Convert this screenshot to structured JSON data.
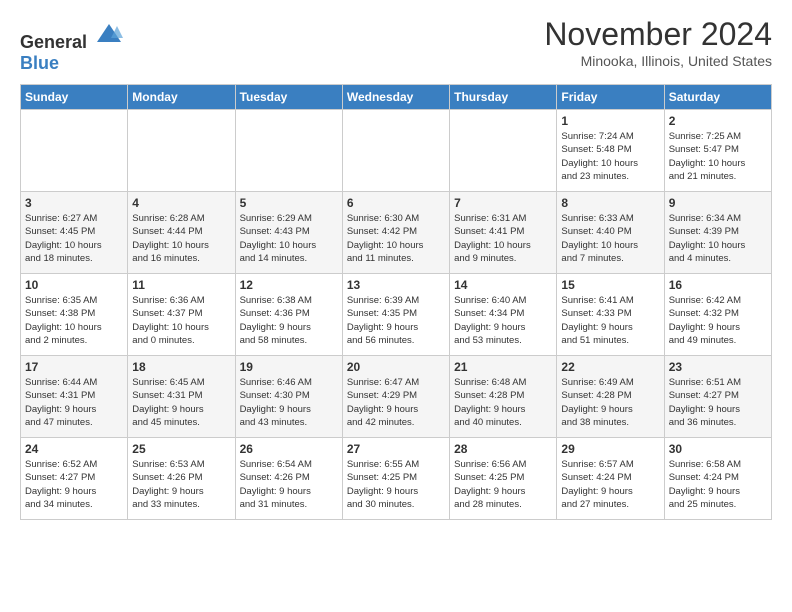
{
  "logo": {
    "text_general": "General",
    "text_blue": "Blue"
  },
  "title": "November 2024",
  "location": "Minooka, Illinois, United States",
  "headers": [
    "Sunday",
    "Monday",
    "Tuesday",
    "Wednesday",
    "Thursday",
    "Friday",
    "Saturday"
  ],
  "rows": [
    [
      {
        "day": "",
        "info": ""
      },
      {
        "day": "",
        "info": ""
      },
      {
        "day": "",
        "info": ""
      },
      {
        "day": "",
        "info": ""
      },
      {
        "day": "",
        "info": ""
      },
      {
        "day": "1",
        "info": "Sunrise: 7:24 AM\nSunset: 5:48 PM\nDaylight: 10 hours\nand 23 minutes."
      },
      {
        "day": "2",
        "info": "Sunrise: 7:25 AM\nSunset: 5:47 PM\nDaylight: 10 hours\nand 21 minutes."
      }
    ],
    [
      {
        "day": "3",
        "info": "Sunrise: 6:27 AM\nSunset: 4:45 PM\nDaylight: 10 hours\nand 18 minutes."
      },
      {
        "day": "4",
        "info": "Sunrise: 6:28 AM\nSunset: 4:44 PM\nDaylight: 10 hours\nand 16 minutes."
      },
      {
        "day": "5",
        "info": "Sunrise: 6:29 AM\nSunset: 4:43 PM\nDaylight: 10 hours\nand 14 minutes."
      },
      {
        "day": "6",
        "info": "Sunrise: 6:30 AM\nSunset: 4:42 PM\nDaylight: 10 hours\nand 11 minutes."
      },
      {
        "day": "7",
        "info": "Sunrise: 6:31 AM\nSunset: 4:41 PM\nDaylight: 10 hours\nand 9 minutes."
      },
      {
        "day": "8",
        "info": "Sunrise: 6:33 AM\nSunset: 4:40 PM\nDaylight: 10 hours\nand 7 minutes."
      },
      {
        "day": "9",
        "info": "Sunrise: 6:34 AM\nSunset: 4:39 PM\nDaylight: 10 hours\nand 4 minutes."
      }
    ],
    [
      {
        "day": "10",
        "info": "Sunrise: 6:35 AM\nSunset: 4:38 PM\nDaylight: 10 hours\nand 2 minutes."
      },
      {
        "day": "11",
        "info": "Sunrise: 6:36 AM\nSunset: 4:37 PM\nDaylight: 10 hours\nand 0 minutes."
      },
      {
        "day": "12",
        "info": "Sunrise: 6:38 AM\nSunset: 4:36 PM\nDaylight: 9 hours\nand 58 minutes."
      },
      {
        "day": "13",
        "info": "Sunrise: 6:39 AM\nSunset: 4:35 PM\nDaylight: 9 hours\nand 56 minutes."
      },
      {
        "day": "14",
        "info": "Sunrise: 6:40 AM\nSunset: 4:34 PM\nDaylight: 9 hours\nand 53 minutes."
      },
      {
        "day": "15",
        "info": "Sunrise: 6:41 AM\nSunset: 4:33 PM\nDaylight: 9 hours\nand 51 minutes."
      },
      {
        "day": "16",
        "info": "Sunrise: 6:42 AM\nSunset: 4:32 PM\nDaylight: 9 hours\nand 49 minutes."
      }
    ],
    [
      {
        "day": "17",
        "info": "Sunrise: 6:44 AM\nSunset: 4:31 PM\nDaylight: 9 hours\nand 47 minutes."
      },
      {
        "day": "18",
        "info": "Sunrise: 6:45 AM\nSunset: 4:31 PM\nDaylight: 9 hours\nand 45 minutes."
      },
      {
        "day": "19",
        "info": "Sunrise: 6:46 AM\nSunset: 4:30 PM\nDaylight: 9 hours\nand 43 minutes."
      },
      {
        "day": "20",
        "info": "Sunrise: 6:47 AM\nSunset: 4:29 PM\nDaylight: 9 hours\nand 42 minutes."
      },
      {
        "day": "21",
        "info": "Sunrise: 6:48 AM\nSunset: 4:28 PM\nDaylight: 9 hours\nand 40 minutes."
      },
      {
        "day": "22",
        "info": "Sunrise: 6:49 AM\nSunset: 4:28 PM\nDaylight: 9 hours\nand 38 minutes."
      },
      {
        "day": "23",
        "info": "Sunrise: 6:51 AM\nSunset: 4:27 PM\nDaylight: 9 hours\nand 36 minutes."
      }
    ],
    [
      {
        "day": "24",
        "info": "Sunrise: 6:52 AM\nSunset: 4:27 PM\nDaylight: 9 hours\nand 34 minutes."
      },
      {
        "day": "25",
        "info": "Sunrise: 6:53 AM\nSunset: 4:26 PM\nDaylight: 9 hours\nand 33 minutes."
      },
      {
        "day": "26",
        "info": "Sunrise: 6:54 AM\nSunset: 4:26 PM\nDaylight: 9 hours\nand 31 minutes."
      },
      {
        "day": "27",
        "info": "Sunrise: 6:55 AM\nSunset: 4:25 PM\nDaylight: 9 hours\nand 30 minutes."
      },
      {
        "day": "28",
        "info": "Sunrise: 6:56 AM\nSunset: 4:25 PM\nDaylight: 9 hours\nand 28 minutes."
      },
      {
        "day": "29",
        "info": "Sunrise: 6:57 AM\nSunset: 4:24 PM\nDaylight: 9 hours\nand 27 minutes."
      },
      {
        "day": "30",
        "info": "Sunrise: 6:58 AM\nSunset: 4:24 PM\nDaylight: 9 hours\nand 25 minutes."
      }
    ]
  ]
}
